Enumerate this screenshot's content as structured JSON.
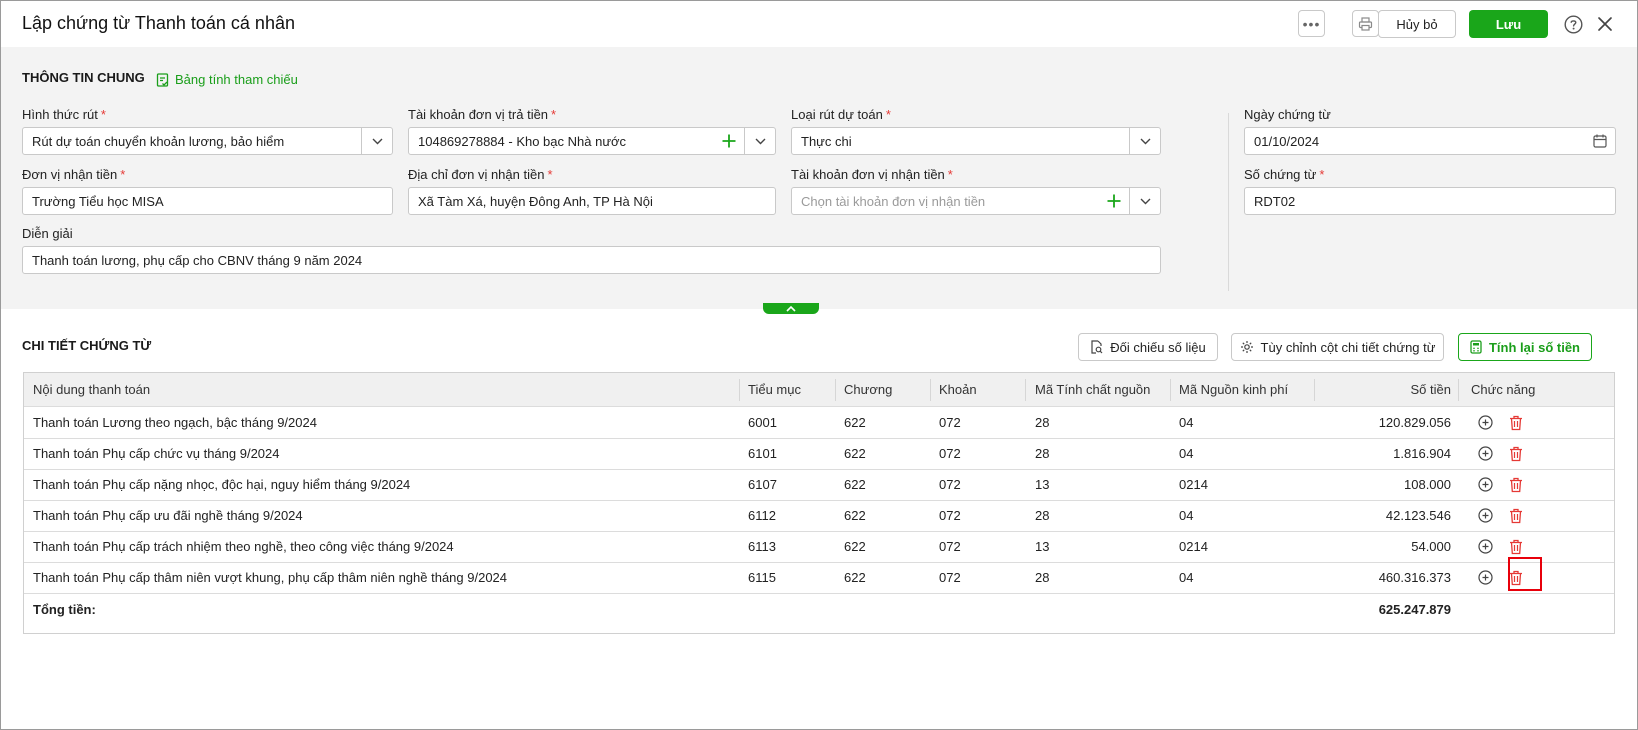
{
  "header": {
    "title": "Lập chứng từ Thanh toán cá nhân",
    "cancel_label": "Hủy bỏ",
    "save_label": "Lưu"
  },
  "general": {
    "section_title": "THÔNG TIN CHUNG",
    "reference_link": "Bảng tính tham chiếu",
    "fields": {
      "withdraw_type": {
        "label": "Hình thức rút",
        "value": "Rút dự toán chuyển khoản lương, bảo hiểm"
      },
      "payer_account": {
        "label": "Tài khoản đơn vị trả tiền",
        "value": "104869278884 - Kho bạc Nhà nước"
      },
      "estimate_type": {
        "label": "Loại rút dự toán",
        "value": "Thực chi"
      },
      "voucher_date": {
        "label": "Ngày chứng từ",
        "value": "01/10/2024"
      },
      "receiver": {
        "label": "Đơn vị nhận tiền",
        "value": "Trường Tiểu học MISA"
      },
      "receiver_address": {
        "label": "Địa chỉ đơn vị nhận tiền",
        "value": "Xã Tàm Xá, huyện Đông Anh, TP Hà Nội"
      },
      "receiver_account": {
        "label": "Tài khoản đơn vị nhận tiền",
        "placeholder": "Chọn tài khoản đơn vị nhận tiền"
      },
      "voucher_no": {
        "label": "Số chứng từ",
        "value": "RDT02"
      },
      "description": {
        "label": "Diễn giải",
        "value": "Thanh toán lương, phụ cấp cho CBNV tháng 9 năm 2024"
      }
    },
    "required_mark": "*"
  },
  "detail": {
    "section_title": "CHI TIẾT CHỨNG TỪ",
    "buttons": {
      "compare": "Đối chiếu số liệu",
      "customize": "Tùy chỉnh cột chi tiết chứng từ",
      "recalc": "Tính lại số tiền"
    },
    "columns": [
      "Nội dung thanh toán",
      "Tiểu mục",
      "Chương",
      "Khoản",
      "Mã Tính chất nguồn",
      "Mã Nguồn kinh phí",
      "Số tiền",
      "Chức năng"
    ],
    "rows": [
      [
        "Thanh toán Lương theo ngạch, bậc tháng 9/2024",
        "6001",
        "622",
        "072",
        "28",
        "04",
        "120.829.056"
      ],
      [
        "Thanh toán Phụ cấp chức vụ tháng 9/2024",
        "6101",
        "622",
        "072",
        "28",
        "04",
        "1.816.904"
      ],
      [
        "Thanh toán Phụ cấp nặng nhọc, độc hại, nguy hiểm tháng 9/2024",
        "6107",
        "622",
        "072",
        "13",
        "0214",
        "108.000"
      ],
      [
        "Thanh toán Phụ cấp ưu đãi nghề tháng 9/2024",
        "6112",
        "622",
        "072",
        "28",
        "04",
        "42.123.546"
      ],
      [
        "Thanh toán Phụ cấp trách nhiệm theo nghề, theo công việc tháng 9/2024",
        "6113",
        "622",
        "072",
        "13",
        "0214",
        "54.000"
      ],
      [
        "Thanh toán Phụ cấp thâm niên vượt khung, phụ cấp thâm niên nghề tháng 9/2024",
        "6115",
        "622",
        "072",
        "28",
        "04",
        "460.316.373"
      ]
    ],
    "total_label": "Tổng tiền:",
    "total_value": "625.247.879"
  },
  "colors": {
    "brand_green": "#1aa61a",
    "required_red": "#e53935",
    "delete_red": "#e53935",
    "highlight_red": "#e8000b"
  }
}
